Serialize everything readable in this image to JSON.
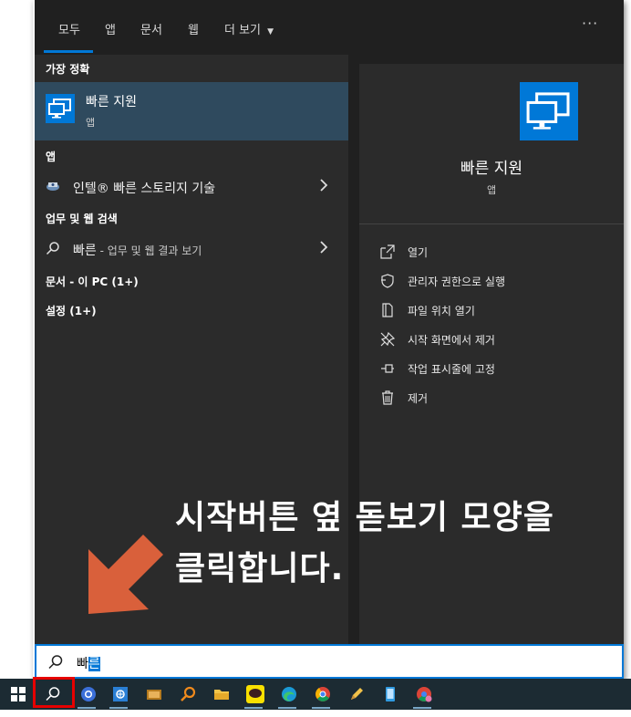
{
  "tabs": {
    "all": "모두",
    "apps": "앱",
    "documents": "문서",
    "web": "웹",
    "more": "더 보기",
    "more_arrow": "▼",
    "dots": "···"
  },
  "left": {
    "best_match_heading": "가장 정확",
    "best_match": {
      "title": "빠른 지원",
      "subtitle": "앱",
      "icon": "monitor-pair-icon"
    },
    "apps_heading": "앱",
    "app_item": {
      "label": "인텔® 빠른 스토리지 기술",
      "icon": "intel-rst-icon"
    },
    "web_heading": "업무 및 웹 검색",
    "web_item": {
      "query": "빠른",
      "suffix": " - 업무 및 웹 결과 보기",
      "icon": "search-icon"
    },
    "docs_heading": "문서 - 이 PC (1+)",
    "settings_heading": "설정 (1+)"
  },
  "right": {
    "title": "빠른 지원",
    "subtitle": "앱",
    "actions": [
      {
        "label": "열기",
        "icon": "open-icon"
      },
      {
        "label": "관리자 권한으로 실행",
        "icon": "shield-icon"
      },
      {
        "label": "파일 위치 열기",
        "icon": "file-location-icon"
      },
      {
        "label": "시작 화면에서 제거",
        "icon": "unpin-start-icon"
      },
      {
        "label": "작업 표시줄에 고정",
        "icon": "pin-taskbar-icon"
      },
      {
        "label": "제거",
        "icon": "trash-icon"
      }
    ]
  },
  "overlay": {
    "line1": "시작버튼 옆 돋보기 모양을",
    "line2": "클릭합니다.",
    "arrow_color": "#d9603b"
  },
  "search": {
    "prefix": "빠",
    "selected": "른"
  },
  "taskbar": {
    "items": [
      "windows-start-icon",
      "search-icon",
      "chrome-alt-icon",
      "photo-viewer-icon",
      "book-icon",
      "search-orange-icon",
      "file-explorer-icon",
      "kakaotalk-icon",
      "edge-icon",
      "chrome-icon",
      "pencil-icon",
      "phone-icon",
      "chrome-profile-icon"
    ]
  },
  "colors": {
    "accent": "#0078d7",
    "highlight_box": "#e60000"
  }
}
